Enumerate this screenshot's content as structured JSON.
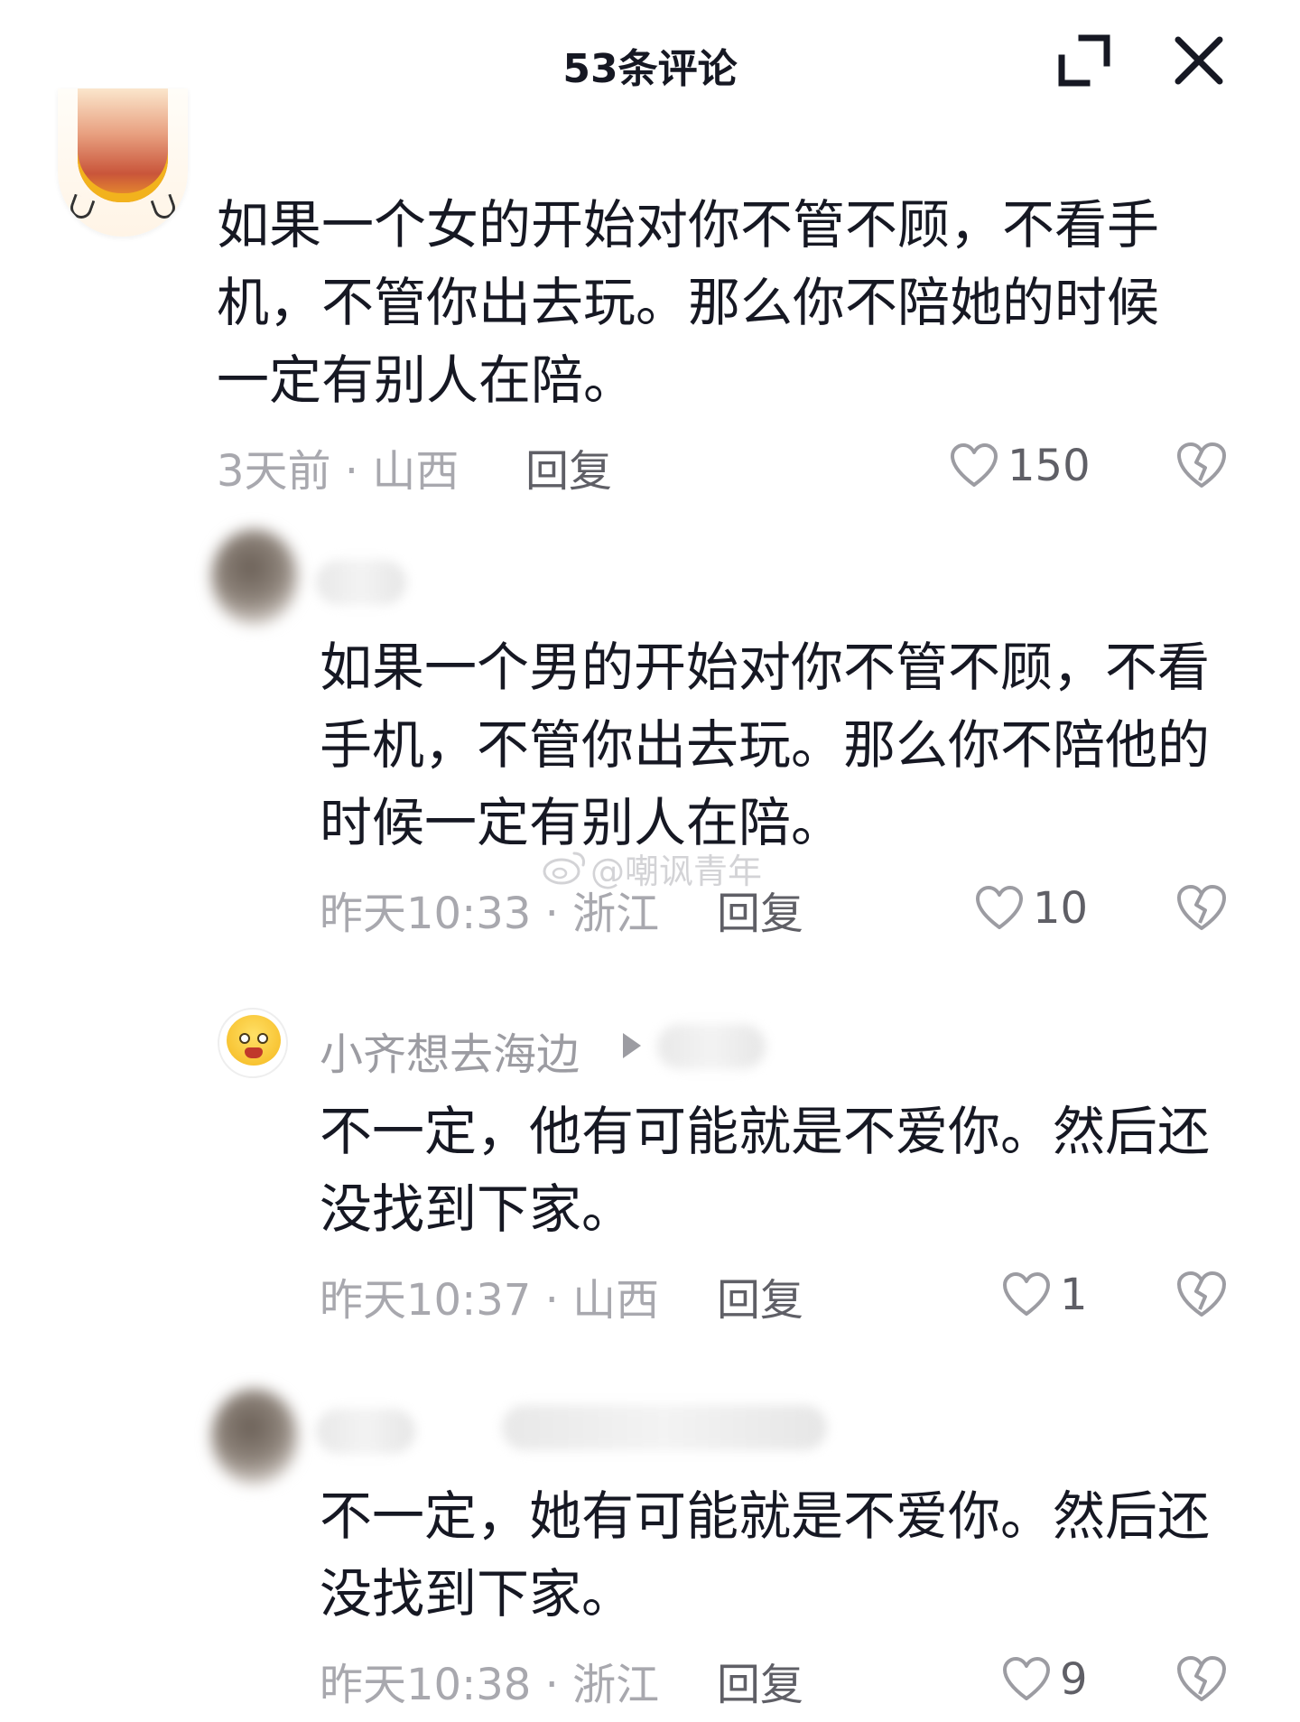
{
  "header": {
    "title": "53条评论",
    "expand_icon": "expand-icon",
    "close_icon": "close-icon"
  },
  "comments": [
    {
      "text": "如果一个女的开始对你不管不顾，不看手机，不管你出去玩。那么你不陪她的时候一定有别人在陪。",
      "meta": "3天前 · 山西",
      "reply_label": "回复",
      "likes": "150"
    },
    {
      "text": "如果一个男的开始对你不管不顾，不看手机，不管你出去玩。那么你不陪他的时候一定有别人在陪。",
      "meta": "昨天10:33 · 浙江",
      "reply_label": "回复",
      "likes": "10"
    },
    {
      "username": "小齐想去海边",
      "text": "不一定，他有可能就是不爱你。然后还没找到下家。",
      "meta": "昨天10:37 · 山西",
      "reply_label": "回复",
      "likes": "1"
    },
    {
      "text": "不一定，她有可能就是不爱你。然后还没找到下家。",
      "meta": "昨天10:38 · 浙江",
      "reply_label": "回复",
      "likes": "9"
    }
  ],
  "watermark": "@嘲讽青年",
  "colors": {
    "primary_text": "#161823",
    "secondary_text": "#a8a8ae",
    "action_text": "#5f5f66"
  }
}
